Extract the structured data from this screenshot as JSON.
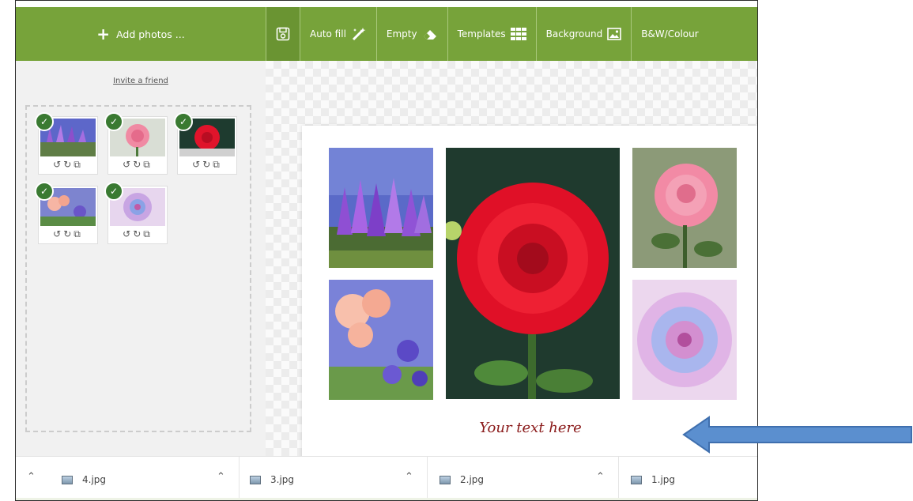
{
  "toolbar": {
    "add_photos": "Add photos ...",
    "auto_fill": "Auto fill",
    "empty": "Empty",
    "templates": "Templates",
    "background": "Background",
    "bw_colour": "B&W/Colour"
  },
  "sidebar": {
    "invite": "Invite a friend",
    "thumb_controls": [
      "rotate-left-icon",
      "rotate-right-icon",
      "crop-icon"
    ],
    "thumbnails": [
      {
        "subject": "purple crocus flowers",
        "selected": true
      },
      {
        "subject": "pink rose",
        "selected": true
      },
      {
        "subject": "red dahlia",
        "selected": true
      },
      {
        "subject": "pink flowers with blue flowers",
        "selected": true
      },
      {
        "subject": "pink and blue dahlia",
        "selected": true
      }
    ]
  },
  "collage": {
    "caption": "Your text here"
  },
  "downloads": [
    {
      "name": "4.jpg"
    },
    {
      "name": "3.jpg"
    },
    {
      "name": "2.jpg"
    },
    {
      "name": "1.jpg"
    }
  ],
  "colors": {
    "toolbar_green": "#77a33a",
    "check_green": "#3a7a32",
    "caption_red": "#8a1a1a",
    "arrow_blue": "#5b8fcf"
  }
}
